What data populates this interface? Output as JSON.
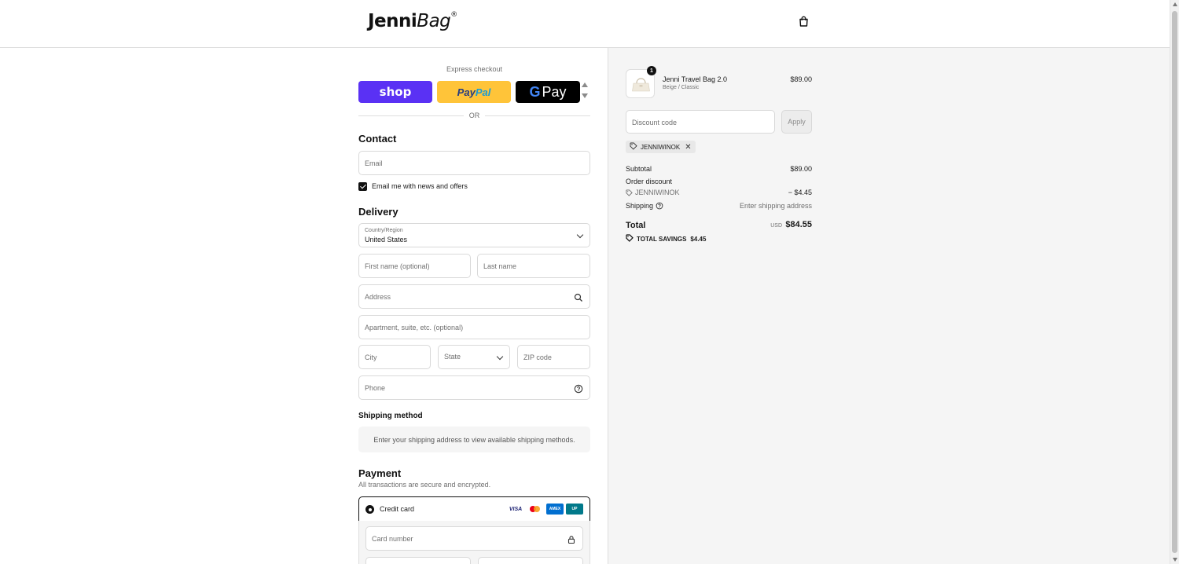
{
  "header": {
    "logo_bold": "Jenni",
    "logo_italic": "Bag",
    "logo_mark": "®",
    "cart_icon": "shopping-bag-icon"
  },
  "express": {
    "label": "Express checkout",
    "shop_label": "shop",
    "paypal_label_a": "Pay",
    "paypal_label_b": "Pal",
    "gpay_g": "G",
    "gpay_label": "Pay",
    "or_label": "OR"
  },
  "contact": {
    "title": "Contact",
    "email_placeholder": "Email",
    "newsletter_label": "Email me with news and offers",
    "newsletter_checked": true
  },
  "delivery": {
    "title": "Delivery",
    "country_label": "Country/Region",
    "country_value": "United States",
    "first_name_placeholder": "First name (optional)",
    "last_name_placeholder": "Last name",
    "address_placeholder": "Address",
    "apartment_placeholder": "Apartment, suite, etc. (optional)",
    "city_placeholder": "City",
    "state_placeholder": "State",
    "zip_placeholder": "ZIP code",
    "phone_placeholder": "Phone"
  },
  "shipping_method": {
    "title": "Shipping method",
    "info": "Enter your shipping address to view available shipping methods."
  },
  "payment": {
    "title": "Payment",
    "note": "All transactions are secure and encrypted.",
    "credit_card_label": "Credit card",
    "card_brands": [
      "VISA",
      "Mastercard",
      "AMERICAN EXPRESS",
      "UnionPay"
    ],
    "card_number_placeholder": "Card number"
  },
  "order": {
    "item_name": "Jenni Travel Bag 2.0",
    "item_variant": "Beige / Classic",
    "item_price": "$89.00",
    "item_quantity": "1",
    "discount_placeholder": "Discount code",
    "apply_label": "Apply",
    "applied_code": "JENNIWINOK",
    "subtotal_label": "Subtotal",
    "subtotal_value": "$89.00",
    "order_discount_label": "Order discount",
    "discount_code_line": "JENNIWINOK",
    "discount_value": "− $4.45",
    "shipping_label": "Shipping",
    "shipping_value": "Enter shipping address",
    "total_label": "Total",
    "total_currency": "USD",
    "total_value": "$84.55",
    "savings_label": "TOTAL SAVINGS",
    "savings_value": "$4.45"
  }
}
